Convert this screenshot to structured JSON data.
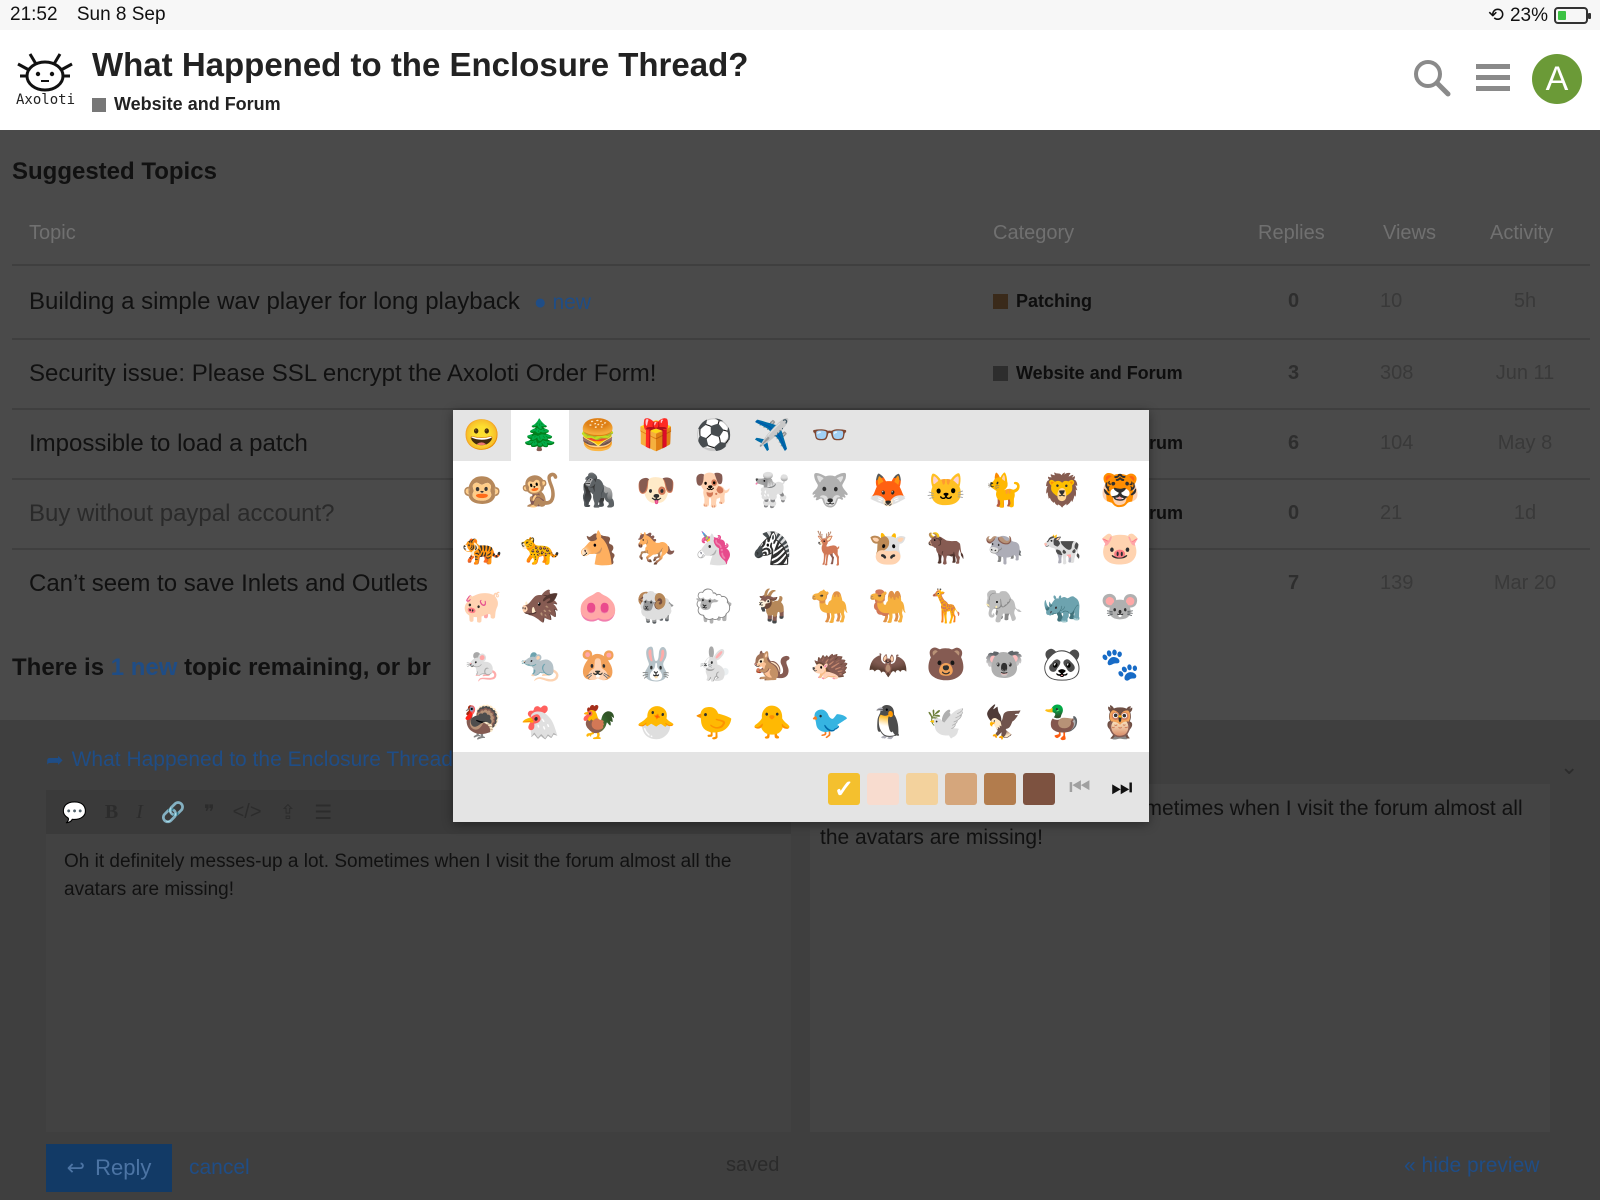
{
  "status": {
    "time": "21:52",
    "date": "Sun 8 Sep",
    "battery": "23%"
  },
  "header": {
    "logo_text": "Axoloti",
    "title": "What Happened to the Enclosure Thread?",
    "category": "Website and Forum",
    "avatar_letter": "A"
  },
  "suggested": {
    "heading": "Suggested Topics",
    "columns": {
      "topic": "Topic",
      "category": "Category",
      "replies": "Replies",
      "views": "Views",
      "activity": "Activity"
    },
    "rows": [
      {
        "title": "Building a simple wav player for long playback",
        "badge": "● new",
        "category": "Patching",
        "cat_color": "#3a2a1a",
        "replies": "0",
        "views": "10",
        "activity": "5h"
      },
      {
        "title": "Security issue: Please SSL encrypt the Axoloti Order Form!",
        "badge": "",
        "category": "Website and Forum",
        "cat_color": "#2d2d2d",
        "replies": "3",
        "views": "308",
        "activity": "Jun 11"
      },
      {
        "title": "Impossible to load a patch",
        "badge": "",
        "category": "orum",
        "cat_color": "",
        "replies": "6",
        "views": "104",
        "activity": "May 8"
      },
      {
        "title": "Buy without paypal account?",
        "badge": "",
        "category": "orum",
        "cat_color": "",
        "replies": "0",
        "views": "21",
        "activity": "1d"
      },
      {
        "title": "Can’t seem to save Inlets and Outlets",
        "badge": "",
        "category": "",
        "cat_color": "",
        "replies": "7",
        "views": "139",
        "activity": "Mar 20"
      }
    ],
    "remaining_pre": "There is ",
    "remaining_link": "1 new",
    "remaining_post": " topic remaining, or br"
  },
  "composer": {
    "reply_to": "What Happened to the Enclosure Thread?",
    "toolbar": [
      "💬",
      "B",
      "I",
      "🔗",
      "❞",
      "</>",
      "⇪",
      "☰"
    ],
    "draft": "Oh it definitely messes-up a lot.  Sometimes when I visit the forum almost all the avatars are missing!",
    "preview": "Oh it definitely messes-up a lot. Sometimes when I visit the forum almost all the avatars are missing!",
    "reply_label": "Reply",
    "cancel_label": "cancel",
    "saved_label": "saved",
    "hide_preview_label": "« hide preview"
  },
  "emoji_picker": {
    "tabs": [
      {
        "name": "people-tab",
        "glyph": "😀"
      },
      {
        "name": "nature-tab",
        "glyph": "🌲"
      },
      {
        "name": "food-tab",
        "glyph": "🍔"
      },
      {
        "name": "celebration-tab",
        "glyph": "🎁"
      },
      {
        "name": "activity-tab",
        "glyph": "⚽"
      },
      {
        "name": "travel-tab",
        "glyph": "✈️"
      },
      {
        "name": "objects-tab",
        "glyph": "👓"
      }
    ],
    "active_tab": 1,
    "emojis": [
      "🐵",
      "🐒",
      "🦍",
      "🐶",
      "🐕",
      "🐩",
      "🐺",
      "🦊",
      "🐱",
      "🐈",
      "🦁",
      "🐯",
      "🐅",
      "🐆",
      "🐴",
      "🐎",
      "🦄",
      "🦓",
      "🦌",
      "🐮",
      "🐂",
      "🐃",
      "🐄",
      "🐷",
      "🐖",
      "🐗",
      "🐽",
      "🐏",
      "🐑",
      "🐐",
      "🐪",
      "🐫",
      "🦒",
      "🐘",
      "🦏",
      "🐭",
      "🐁",
      "🐀",
      "🐹",
      "🐰",
      "🐇",
      "🐿️",
      "🦔",
      "🦇",
      "🐻",
      "🐨",
      "🐼",
      "🐾",
      "🦃",
      "🐔",
      "🐓",
      "🐣",
      "🐤",
      "🐥",
      "🐦",
      "🐧",
      "🕊️",
      "🦅",
      "🦆",
      "🦉"
    ],
    "skin_tones": [
      "#f4c02e",
      "#f8dccf",
      "#f3d29d",
      "#d5a67c",
      "#b27c4d",
      "#7d5240"
    ],
    "selected_tone": 0,
    "check": "✓",
    "prev": "⏮",
    "next": "⏭"
  }
}
